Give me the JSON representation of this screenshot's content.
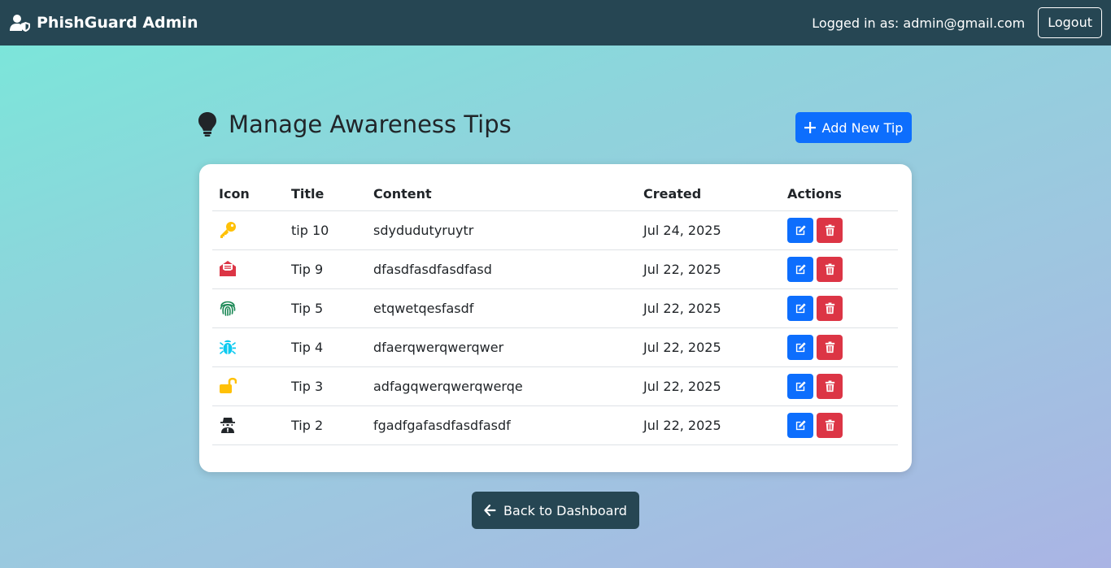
{
  "navbar": {
    "brand": "PhishGuard Admin",
    "brand_icon": "user-shield-icon",
    "logged_in_text": "Logged in as: admin@gmail.com",
    "logout_label": "Logout"
  },
  "page": {
    "title": "Manage Awareness Tips",
    "title_icon": "lightbulb-icon",
    "add_button_label": "Add New Tip",
    "back_button_label": "Back to Dashboard"
  },
  "table": {
    "headers": [
      "Icon",
      "Title",
      "Content",
      "Created",
      "Actions"
    ],
    "rows": [
      {
        "icon": "key-icon",
        "icon_color": "#ffc107",
        "title": "tip 10",
        "content": "sdydudutyruytr",
        "created": "Jul 24, 2025"
      },
      {
        "icon": "envelope-open-icon",
        "icon_color": "#dc3545",
        "title": "Tip 9",
        "content": "dfasdfasdfasdfasd",
        "created": "Jul 22, 2025"
      },
      {
        "icon": "fingerprint-icon",
        "icon_color": "#198754",
        "title": "Tip 5",
        "content": "etqwetqesfasdf",
        "created": "Jul 22, 2025"
      },
      {
        "icon": "bug-icon",
        "icon_color": "#0dcaf0",
        "title": "Tip 4",
        "content": "dfaerqwerqwerqwer",
        "created": "Jul 22, 2025"
      },
      {
        "icon": "unlock-icon",
        "icon_color": "#ffc107",
        "title": "Tip 3",
        "content": "adfagqwerqwerqwerqe",
        "created": "Jul 22, 2025"
      },
      {
        "icon": "user-secret-icon",
        "icon_color": "#212529",
        "title": "Tip 2",
        "content": "fgadfgafasdfasdfasdf",
        "created": "Jul 22, 2025"
      }
    ]
  },
  "colors": {
    "navbar": "#264653",
    "primary": "#0d6efd",
    "danger": "#dc3545"
  }
}
